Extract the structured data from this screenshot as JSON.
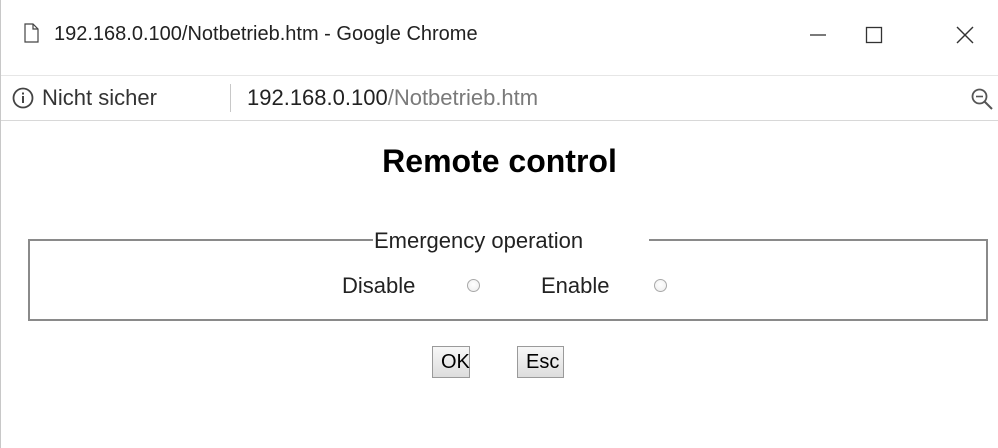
{
  "window": {
    "title": "192.168.0.100/Notbetrieb.htm - Google Chrome"
  },
  "addressbar": {
    "security_label": "Nicht sicher",
    "url_host": "192.168.0.100",
    "url_path": "/Notbetrieb.htm"
  },
  "page": {
    "title": "Remote control",
    "fieldset": {
      "legend": "Emergency operation",
      "options": [
        {
          "label": "Disable",
          "checked": false
        },
        {
          "label": "Enable",
          "checked": false
        }
      ]
    },
    "buttons": {
      "ok_label": "OK",
      "esc_label": "Esc"
    }
  },
  "icons": {
    "page": "page-icon",
    "minimize": "minimize-icon",
    "maximize": "maximize-icon",
    "close": "close-icon",
    "info": "info-icon",
    "zoom": "zoom-icon"
  }
}
